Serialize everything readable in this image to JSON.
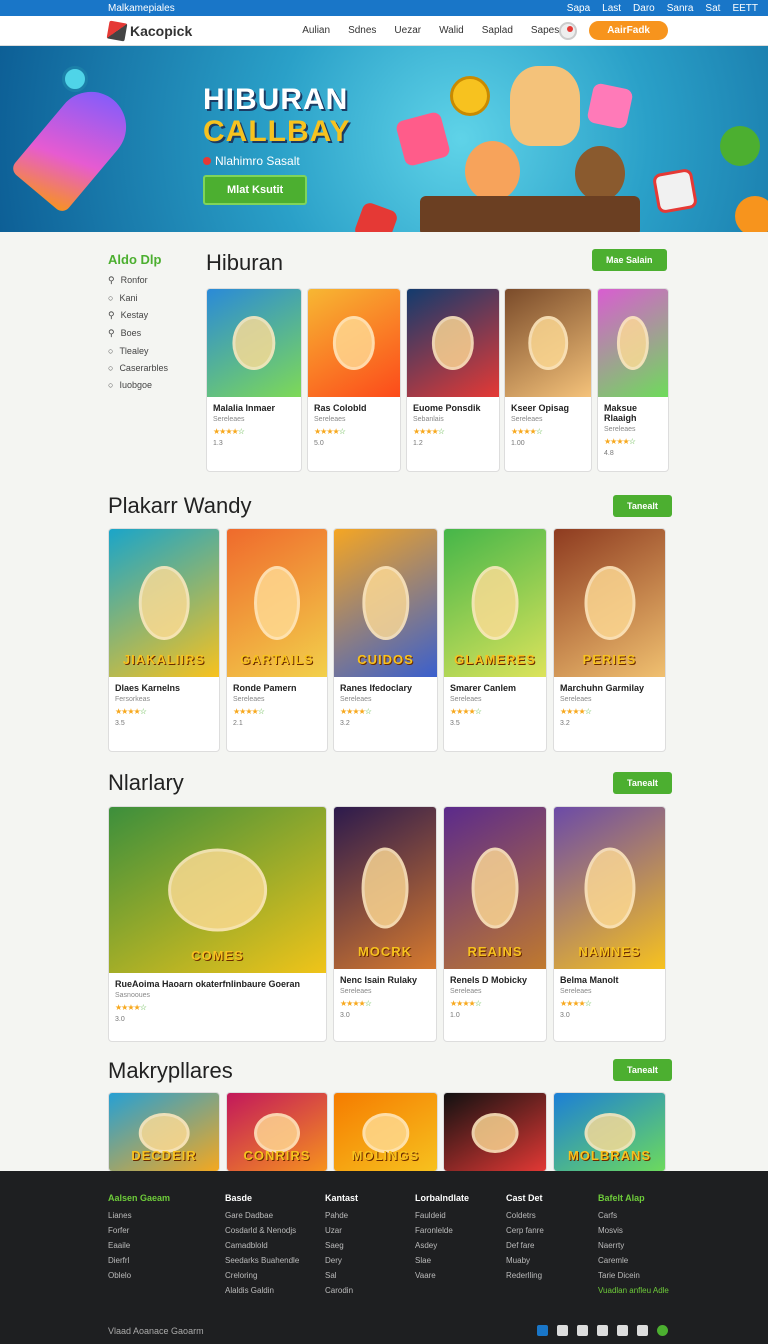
{
  "topbar": {
    "brand": "Malkamepiales",
    "links": [
      "Sapa",
      "Last",
      "Daro",
      "Sanra",
      "Sat",
      "EETT"
    ]
  },
  "nav": {
    "logo": "Kacopick",
    "links": [
      "Aulian",
      "Sdnes",
      "Uezar",
      "Walid",
      "Saplad",
      "Sapes"
    ],
    "cta": "AairFadk"
  },
  "hero": {
    "title_line1": "HIBURAN",
    "title_line2": "CALLBAY",
    "subtitle": "Nlahimro Sasalt",
    "button": "Mlat Ksutit"
  },
  "sidebar": {
    "title": "Aldo Dlp",
    "items": [
      "Ronfor",
      "Kani",
      "Kestay",
      "Boes",
      "Tlealey",
      "Caserarbles",
      "Iuobgoe"
    ]
  },
  "sections": [
    {
      "title": "Hiburan",
      "button": "Mae Salain",
      "cards": [
        {
          "name": "Malalia Inmaer",
          "cat": "Sereleaes",
          "stats": "1.3",
          "colors": [
            "#2a8ad8",
            "#7ed957"
          ]
        },
        {
          "name": "Ras Colobld",
          "cat": "Sereleaes",
          "stats": "5.0",
          "colors": [
            "#f7b733",
            "#fc4a1a"
          ]
        },
        {
          "name": "Euome Ponsdik",
          "cat": "Sebanlais",
          "stats": "1.2",
          "colors": [
            "#123b6e",
            "#e53935"
          ]
        },
        {
          "name": "Kseer Opisag",
          "cat": "Sereleaes",
          "stats": "1.00",
          "colors": [
            "#7a4b2a",
            "#f4c27a"
          ]
        },
        {
          "name": "Maksue Rlaaigh",
          "cat": "Sereleaes",
          "stats": "4.8",
          "colors": [
            "#d95dd1",
            "#6edb5b"
          ]
        }
      ]
    },
    {
      "title": "Plakarr Wandy",
      "button": "Tanealt",
      "cards": [
        {
          "name": "Dlaes Karnelns",
          "cat": "Fersorkeas",
          "stats": "3.5",
          "tag": "JIAKALIIRS",
          "colors": [
            "#1aa5c9",
            "#f7c21f"
          ]
        },
        {
          "name": "Ronde Pamern",
          "cat": "Sereleaes",
          "stats": "2.1",
          "tag": "GARTAILS",
          "colors": [
            "#ef6a2c",
            "#f2d04b"
          ]
        },
        {
          "name": "Ranes Ifedoclary",
          "cat": "Sereleaes",
          "stats": "3.2",
          "tag": "CUIDOS",
          "colors": [
            "#f5a623",
            "#3a5fcd"
          ]
        },
        {
          "name": "Smarer Canlem",
          "cat": "Sereleaes",
          "stats": "3.5",
          "tag": "GLAMERES",
          "colors": [
            "#45b649",
            "#dce35b"
          ]
        },
        {
          "name": "Marchuhn Garmilay",
          "cat": "Sereleaes",
          "stats": "3.2",
          "tag": "PERIES",
          "colors": [
            "#8e3b20",
            "#f0c070"
          ]
        }
      ]
    },
    {
      "title": "Nlarlary",
      "button": "Tanealt",
      "cards": [
        {
          "name": "RueAoima Haoarn okaterfnlinbaure Goeran",
          "cat": "Sasnooues",
          "stats": "3.0",
          "tag": "COMES",
          "colors": [
            "#3c8f3c",
            "#f0c419"
          ]
        },
        {
          "name": "Nenc Isain Rulaky",
          "cat": "Sereleaes",
          "stats": "3.0",
          "tag": "MOCRK",
          "colors": [
            "#2c1a4d",
            "#d67a2e"
          ]
        },
        {
          "name": "Renels D Mobicky",
          "cat": "Sereleaes",
          "stats": "1.0",
          "tag": "REAINS",
          "colors": [
            "#5b2a8c",
            "#c07a2e"
          ]
        },
        {
          "name": "Belma Manolt",
          "cat": "Sereleaes",
          "stats": "3.0",
          "tag": "NAMNES",
          "colors": [
            "#6b4aa8",
            "#f7c21f"
          ]
        }
      ]
    },
    {
      "title": "Makrypllares",
      "button": "Tanealt",
      "cards": [
        {
          "name": "",
          "cat": "",
          "stats": "",
          "tag": "DECDEIR",
          "colors": [
            "#26a0d4",
            "#f7a81d"
          ]
        },
        {
          "name": "",
          "cat": "",
          "stats": "",
          "tag": "CONRIRS",
          "colors": [
            "#c2185b",
            "#f7941d"
          ]
        },
        {
          "name": "",
          "cat": "",
          "stats": "",
          "tag": "MOLINGS",
          "colors": [
            "#f57c00",
            "#f7c21f"
          ]
        },
        {
          "name": "",
          "cat": "",
          "stats": "",
          "tag": "",
          "colors": [
            "#111111",
            "#e53935"
          ]
        },
        {
          "name": "",
          "cat": "",
          "stats": "",
          "tag": "MOLBRANS",
          "colors": [
            "#1c7fd6",
            "#6edb5b"
          ]
        }
      ]
    }
  ],
  "footer": {
    "cols": [
      {
        "title": "Aalsen Gaeam",
        "items": [
          "Lianes",
          "Forfer",
          "Eaaile",
          "Dierfrl",
          "Oblelo"
        ]
      },
      {
        "title": "Basde",
        "items": [
          "Gare Dadbae",
          "Cosdarld & Nenodjs",
          "Camadblold",
          "Seedarks Buahendle",
          "Creloring",
          "Alaldis Galdin"
        ]
      },
      {
        "title": "Kantast",
        "items": [
          "Pahde",
          "Uzar",
          "Saeg",
          "Dery",
          "Sal",
          "Carodin"
        ]
      },
      {
        "title": "Lorbalndlate",
        "items": [
          "Fauldeid",
          "Faronlelde",
          "Asdey",
          "Slae",
          "Vaare"
        ]
      },
      {
        "title": "Cast Det",
        "items": [
          "Coldetrs",
          "Cerp fanre",
          "Def fare",
          "Muaby",
          "Rederlling"
        ]
      },
      {
        "title": "Bafelt Alap",
        "items": [
          "Carfs",
          "Mosvis",
          "Naerrty",
          "Caremle",
          "Tarie Dicein",
          "Vuadlan anfleu Adle"
        ]
      }
    ],
    "copyright": "Vlaad Aoanace Gaoarm"
  }
}
